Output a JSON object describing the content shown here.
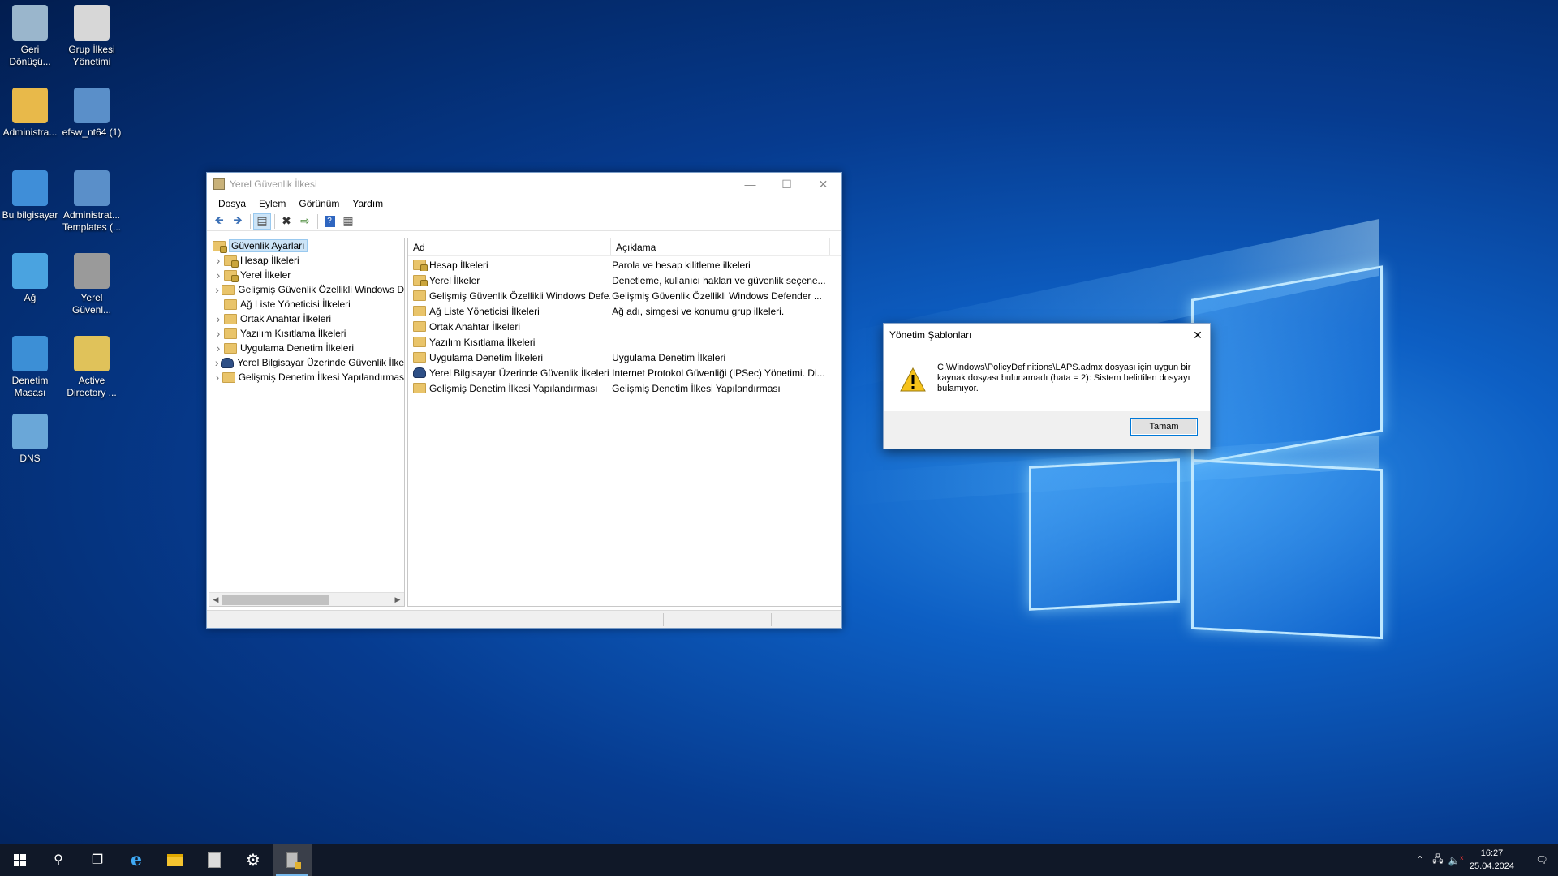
{
  "desktop": {
    "icons": [
      {
        "label": "Geri\nDönüşü...",
        "icon": "recycle-bin-icon"
      },
      {
        "label": "Grup İlkesi\nYönetimi",
        "icon": "group-policy-icon"
      },
      {
        "label": "Administra...",
        "icon": "user-folder-icon"
      },
      {
        "label": "efsw_nt64 (1)",
        "icon": "installer-icon"
      },
      {
        "label": "Bu bilgisayar",
        "icon": "computer-icon"
      },
      {
        "label": "Administrat...\nTemplates (...",
        "icon": "installer-icon"
      },
      {
        "label": "Ağ",
        "icon": "network-icon"
      },
      {
        "label": "Yerel\nGüvenl...",
        "icon": "local-security-icon"
      },
      {
        "label": "Denetim\nMasası",
        "icon": "control-panel-icon"
      },
      {
        "label": "Active\nDirectory ...",
        "icon": "active-directory-icon"
      },
      {
        "label": "DNS",
        "icon": "dns-icon"
      }
    ]
  },
  "window": {
    "title": "Yerel Güvenlik İlkesi",
    "menu": [
      "Dosya",
      "Eylem",
      "Görünüm",
      "Yardım"
    ],
    "tree": {
      "root": "Güvenlik Ayarları",
      "items": [
        {
          "label": "Hesap İlkeleri",
          "icon": "lock-folder",
          "expandable": true
        },
        {
          "label": "Yerel İlkeler",
          "icon": "lock-folder",
          "expandable": true
        },
        {
          "label": "Gelişmiş Güvenlik Özellikli Windows D",
          "icon": "folder",
          "expandable": true
        },
        {
          "label": "Ağ Liste Yöneticisi İlkeleri",
          "icon": "folder",
          "expandable": false
        },
        {
          "label": "Ortak Anahtar İlkeleri",
          "icon": "folder",
          "expandable": true
        },
        {
          "label": "Yazılım Kısıtlama İlkeleri",
          "icon": "folder",
          "expandable": true
        },
        {
          "label": "Uygulama Denetim İlkeleri",
          "icon": "folder",
          "expandable": true
        },
        {
          "label": "Yerel Bilgisayar Üzerinde Güvenlik İlke",
          "icon": "shield",
          "expandable": true
        },
        {
          "label": "Gelişmiş Denetim İlkesi Yapılandırmas",
          "icon": "folder",
          "expandable": true
        }
      ]
    },
    "list": {
      "columns": [
        "Ad",
        "Açıklama"
      ],
      "rows": [
        {
          "name": "Hesap İlkeleri",
          "desc": "Parola ve hesap kilitleme ilkeleri",
          "icon": "lock-folder"
        },
        {
          "name": "Yerel İlkeler",
          "desc": "Denetleme, kullanıcı hakları ve güvenlik seçene...",
          "icon": "lock-folder"
        },
        {
          "name": "Gelişmiş Güvenlik Özellikli Windows Defe...",
          "desc": "Gelişmiş Güvenlik Özellikli Windows Defender ...",
          "icon": "folder"
        },
        {
          "name": "Ağ Liste Yöneticisi İlkeleri",
          "desc": "Ağ adı, simgesi ve konumu grup ilkeleri.",
          "icon": "folder"
        },
        {
          "name": "Ortak Anahtar İlkeleri",
          "desc": "",
          "icon": "folder"
        },
        {
          "name": "Yazılım Kısıtlama İlkeleri",
          "desc": "",
          "icon": "folder"
        },
        {
          "name": "Uygulama Denetim İlkeleri",
          "desc": "Uygulama Denetim İlkeleri",
          "icon": "folder"
        },
        {
          "name": "Yerel Bilgisayar Üzerinde Güvenlik İlkeleri",
          "desc": "Internet Protokol Güvenliği (IPSec) Yönetimi. Di...",
          "icon": "shield"
        },
        {
          "name": "Gelişmiş Denetim İlkesi Yapılandırması",
          "desc": "Gelişmiş Denetim İlkesi Yapılandırması",
          "icon": "folder"
        }
      ]
    }
  },
  "dialog": {
    "title": "Yönetim Şablonları",
    "message": "C:\\Windows\\PolicyDefinitions\\LAPS.admx dosyası için uygun bir kaynak dosyası bulunamadı (hata = 2): Sistem belirtilen dosyayı bulamıyor.",
    "ok_label": "Tamam"
  },
  "taskbar": {
    "time": "16:27",
    "date": "25.04.2024"
  }
}
